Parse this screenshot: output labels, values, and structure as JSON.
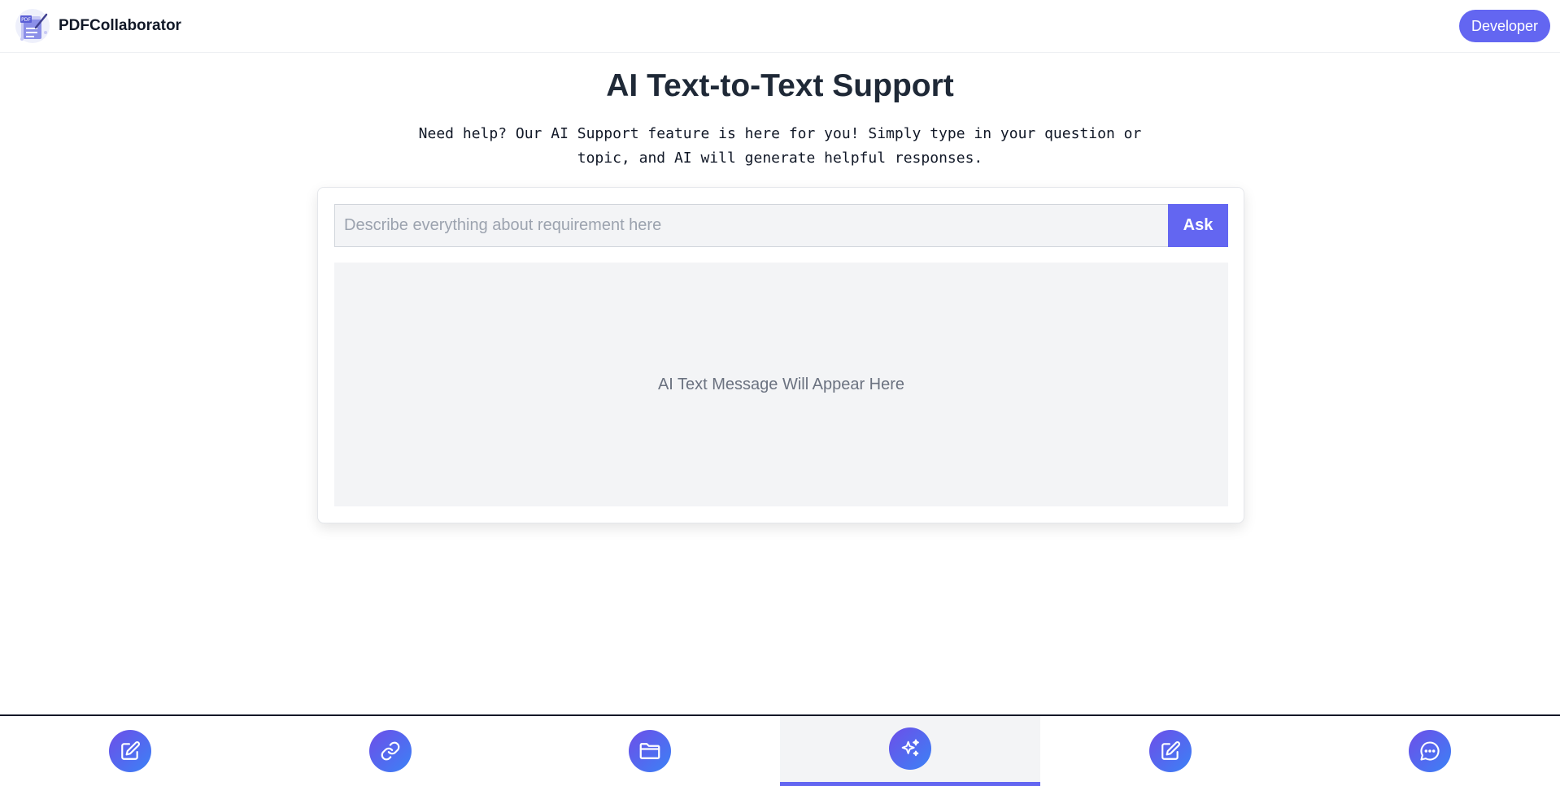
{
  "header": {
    "app_name": "PDFCollaborator",
    "developer_label": "Developer",
    "logo_text": "PDF"
  },
  "main": {
    "title": "AI Text-to-Text Support",
    "subtitle_line1": "Need help? Our AI Support feature is here for you! Simply type in your question or",
    "subtitle_line2": "topic, and AI will generate helpful responses.",
    "input_placeholder": "Describe everything about requirement here",
    "input_value": "",
    "ask_label": "Ask",
    "response_placeholder": "AI Text Message Will Appear Here"
  },
  "bottom_nav": {
    "items": [
      {
        "icon": "edit-icon",
        "active": false
      },
      {
        "icon": "link-icon",
        "active": false
      },
      {
        "icon": "folder-icon",
        "active": false
      },
      {
        "icon": "sparkles-icon",
        "active": true
      },
      {
        "icon": "edit-icon",
        "active": false
      },
      {
        "icon": "chat-icon",
        "active": false
      }
    ]
  },
  "colors": {
    "accent": "#6366f1",
    "panel_bg": "#f3f4f6",
    "icon_gradient_start": "#6d4ee8",
    "icon_gradient_end": "#3b82f6"
  }
}
